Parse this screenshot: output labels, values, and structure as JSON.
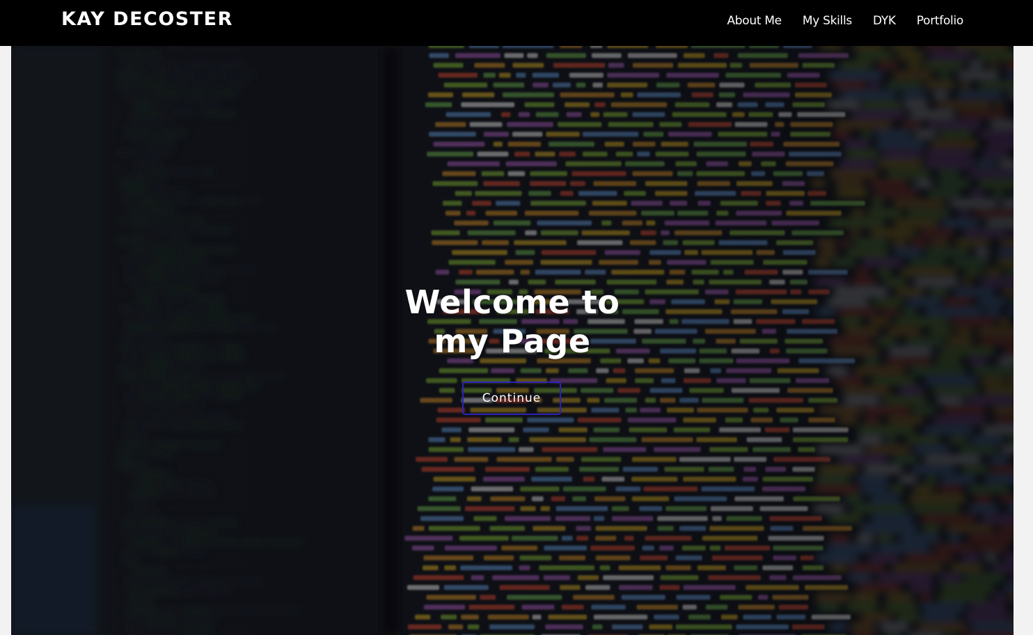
{
  "nav": {
    "brand": "KAY DECOSTER",
    "links": [
      "About Me",
      "My Skills",
      "DYK",
      "Portfolio"
    ]
  },
  "hero": {
    "title": "Welcome to my Page",
    "button_label": "Continue",
    "background_image": "blurred code editor"
  },
  "colors": {
    "navbar": "#000000",
    "button_border": "#2b24b8",
    "text": "#ffffff"
  }
}
